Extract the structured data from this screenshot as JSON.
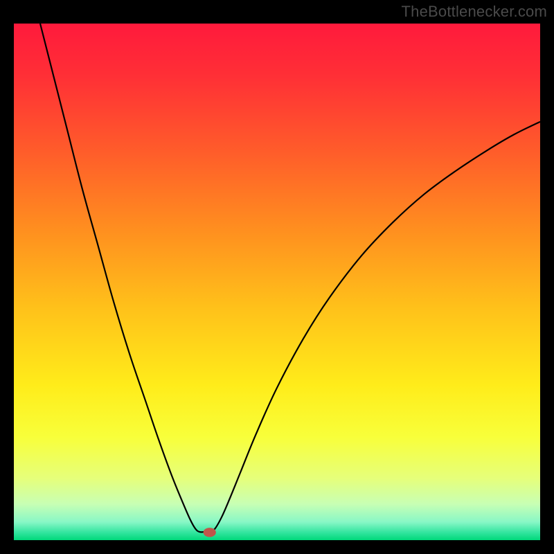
{
  "watermark": "TheBottleneсker.com",
  "chart_data": {
    "type": "line",
    "title": "",
    "xlabel": "",
    "ylabel": "",
    "xlim": [
      0,
      100
    ],
    "ylim": [
      0,
      100
    ],
    "gradient_stops": [
      {
        "offset": 0.0,
        "color": "#ff1a3c"
      },
      {
        "offset": 0.1,
        "color": "#ff2f36"
      },
      {
        "offset": 0.25,
        "color": "#ff5d2a"
      },
      {
        "offset": 0.4,
        "color": "#ff8f1f"
      },
      {
        "offset": 0.55,
        "color": "#ffc11a"
      },
      {
        "offset": 0.7,
        "color": "#ffec1a"
      },
      {
        "offset": 0.8,
        "color": "#f8ff3a"
      },
      {
        "offset": 0.88,
        "color": "#e6ff7a"
      },
      {
        "offset": 0.93,
        "color": "#c8ffb4"
      },
      {
        "offset": 0.965,
        "color": "#88f7c6"
      },
      {
        "offset": 0.985,
        "color": "#33e59f"
      },
      {
        "offset": 1.0,
        "color": "#00d87a"
      }
    ],
    "series": [
      {
        "name": "bottleneck-curve",
        "type": "line",
        "color": "#000000",
        "width": 2.2,
        "points": [
          {
            "x": 5.0,
            "y": 100.0
          },
          {
            "x": 7.0,
            "y": 92.0
          },
          {
            "x": 10.0,
            "y": 80.0
          },
          {
            "x": 13.0,
            "y": 68.0
          },
          {
            "x": 16.0,
            "y": 57.0
          },
          {
            "x": 19.0,
            "y": 46.0
          },
          {
            "x": 22.0,
            "y": 36.0
          },
          {
            "x": 25.0,
            "y": 27.0
          },
          {
            "x": 27.5,
            "y": 19.5
          },
          {
            "x": 30.0,
            "y": 12.5
          },
          {
            "x": 32.0,
            "y": 7.5
          },
          {
            "x": 33.5,
            "y": 4.0
          },
          {
            "x": 34.5,
            "y": 2.2
          },
          {
            "x": 35.3,
            "y": 1.6
          },
          {
            "x": 36.3,
            "y": 1.6
          },
          {
            "x": 37.2,
            "y": 1.5
          },
          {
            "x": 38.2,
            "y": 2.2
          },
          {
            "x": 39.5,
            "y": 4.5
          },
          {
            "x": 41.0,
            "y": 8.0
          },
          {
            "x": 43.0,
            "y": 13.0
          },
          {
            "x": 46.0,
            "y": 20.5
          },
          {
            "x": 50.0,
            "y": 29.5
          },
          {
            "x": 55.0,
            "y": 39.0
          },
          {
            "x": 60.0,
            "y": 47.0
          },
          {
            "x": 66.0,
            "y": 55.0
          },
          {
            "x": 72.0,
            "y": 61.5
          },
          {
            "x": 78.0,
            "y": 67.0
          },
          {
            "x": 84.0,
            "y": 71.5
          },
          {
            "x": 90.0,
            "y": 75.5
          },
          {
            "x": 95.0,
            "y": 78.5
          },
          {
            "x": 100.0,
            "y": 81.0
          }
        ]
      }
    ],
    "marker": {
      "x": 37.2,
      "y": 1.5,
      "rx": 1.2,
      "ry": 0.9,
      "color": "#c0554a"
    }
  }
}
